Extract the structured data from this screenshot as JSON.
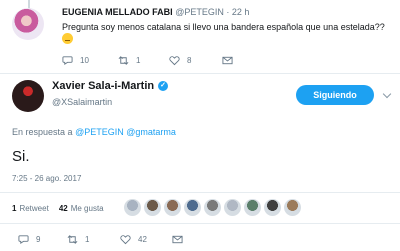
{
  "parent_tweet": {
    "display_name": "EUGENIA MELLADO FABI",
    "handle": "@PETEGIN",
    "time": "· 22 h",
    "text": "Pregunta soy menos catalana si llevo una bandera española que una estelada??",
    "replies": "10",
    "retweets": "1",
    "likes": "8"
  },
  "main_tweet": {
    "display_name": "Xavier Sala-i-Martin",
    "handle": "@XSalaimartin",
    "follow_label": "Siguiendo",
    "reply_prefix": "En respuesta a",
    "reply_users": [
      "@PETEGIN",
      "@gmatarma"
    ],
    "text": "Si.",
    "timestamp": "7:25 - 26 ago. 2017",
    "retweet_count": "1",
    "retweet_label": "Retweet",
    "like_count": "42",
    "like_label": "Me gusta",
    "replies": "9",
    "retweets": "1",
    "likes": "42"
  },
  "colors": {
    "accent": "#1da1f2",
    "muted": "#657786",
    "text": "#14171a",
    "divider": "#e6ecf0"
  },
  "liker_avatar_colors": [
    "#a8b3c1",
    "#6b5a4a",
    "#8a6b55",
    "#4f6c8f",
    "#7a7a7a",
    "#b0b8c4",
    "#5b7f6b",
    "#3f3f3f",
    "#9b7b5b"
  ]
}
